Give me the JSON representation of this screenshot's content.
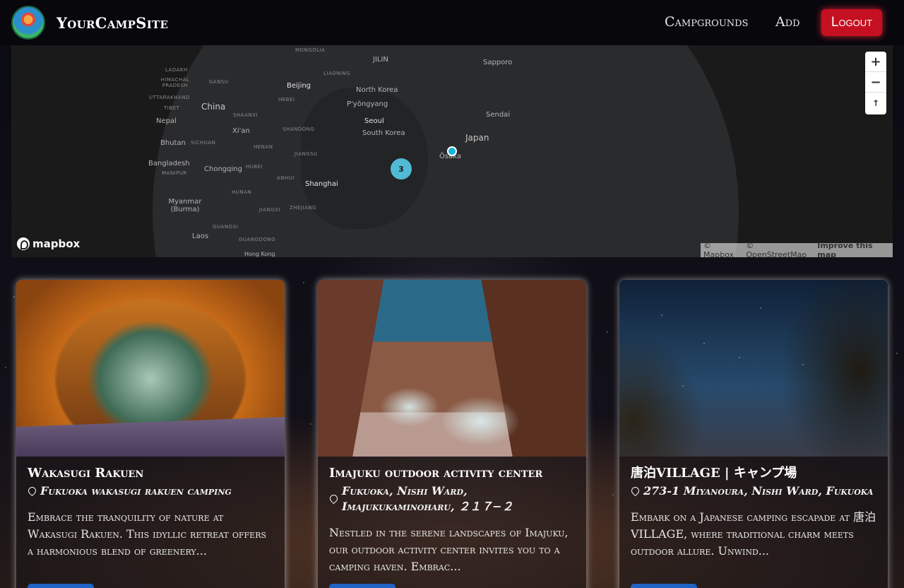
{
  "navbar": {
    "brand": "YourCampSite",
    "links": [
      "Campgrounds",
      "Add"
    ],
    "logout": "Logout"
  },
  "map": {
    "cluster_count": "3",
    "labels": {
      "mongolia": "MONGOLIA",
      "jilin": "JILIN",
      "sapporo": "Sapporo",
      "ladakh": "LADAKH",
      "himachal": "HIMACHAL PRADESH",
      "gansu": "GANSU",
      "liaoning": "LIAONING",
      "beijing": "Beijing",
      "north_korea": "North Korea",
      "uttarakhand": "UTTARAKHAND",
      "hebei": "HEBEI",
      "pyongyang": "P'yŏngyang",
      "tibet": "TIBET",
      "china": "China",
      "shanxi": "SHAANXI",
      "sendai": "Sendai",
      "nepal": "Nepal",
      "xian": "Xi'an",
      "seoul": "Seoul",
      "shandong": "SHANDONG",
      "south_korea": "South Korea",
      "japan": "Japan",
      "bhutan": "Bhutan",
      "sichuan": "SICHUAN",
      "henan": "HENAN",
      "jiangsu": "JIANGSU",
      "osaka": "Ōsaka",
      "bangladesh": "Bangladesh",
      "manipur": "MANIPUR",
      "chongqing": "Chongqing",
      "hubei": "HUBEI",
      "anhui": "ANHUI",
      "shanghai": "Shanghai",
      "hunan": "HUNAN",
      "myanmar": "Myanmar (Burma)",
      "jiangxi": "JIANGXI",
      "zhejiang": "ZHEJIANG",
      "guangxi": "GUANGXI",
      "laos": "Laos",
      "guangdong": "GUANGDONG",
      "hongkong": "Hong Kong"
    },
    "controls": {
      "zoom_in": "+",
      "zoom_out": "−",
      "compass": "↑"
    },
    "logo": "mapbox",
    "attribution": [
      "© Mapbox",
      "© OpenStreetMap",
      "Improve this map"
    ]
  },
  "campgrounds": [
    {
      "title": "Wakasugi Rakuen",
      "location": "Fukuoka wakasugi rakuen camping",
      "description": "Embrace the tranquility of nature at Wakasugi Rakuen. This idyllic retreat offers a harmonious blend of greenery..."
    },
    {
      "title": "Imajuku outdoor activity center",
      "location": "Fukuoka, Nishi Ward, Imajukukaminoharu, ２１７−２",
      "description": "Nestled in the serene landscapes of Imajuku, our outdoor activity center invites you to a camping haven. Embrac..."
    },
    {
      "title": "唐泊VILLAGE | キャンプ場",
      "location": "273-1 Miyanoura, Nishi Ward, Fukuoka",
      "description": "Embark on a Japanese camping escapade at 唐泊VILLAGE, where traditional charm meets outdoor allure. Unwind..."
    }
  ],
  "icons": {
    "logo": "campsite-logo-icon",
    "pin": "map-pin-icon"
  }
}
